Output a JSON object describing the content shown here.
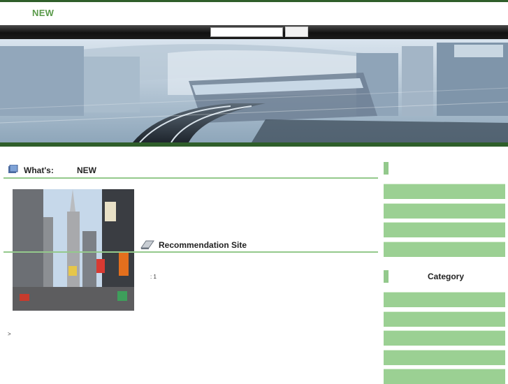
{
  "header": {
    "logo": "NEW"
  },
  "search": {
    "placeholder": "",
    "button_label": ""
  },
  "whats_new": {
    "label_prefix": "What's:",
    "label_suffix": "NEW"
  },
  "recommendation": {
    "title": "Recommendation Site",
    "count_text": ": 1"
  },
  "footer": {
    "arrow": ">"
  },
  "sidebar": {
    "top_menu_items": [
      "",
      "",
      "",
      ""
    ],
    "category_title": "Category",
    "category_items": [
      "",
      "",
      "",
      "",
      ""
    ]
  },
  "colors": {
    "accent_green": "#5a9a4a",
    "dark_green": "#2f5e2a",
    "menu_green": "#9bd093"
  },
  "icons": {
    "whats_new_icon": "book-icon",
    "recommendation_icon": "open-book-icon"
  }
}
